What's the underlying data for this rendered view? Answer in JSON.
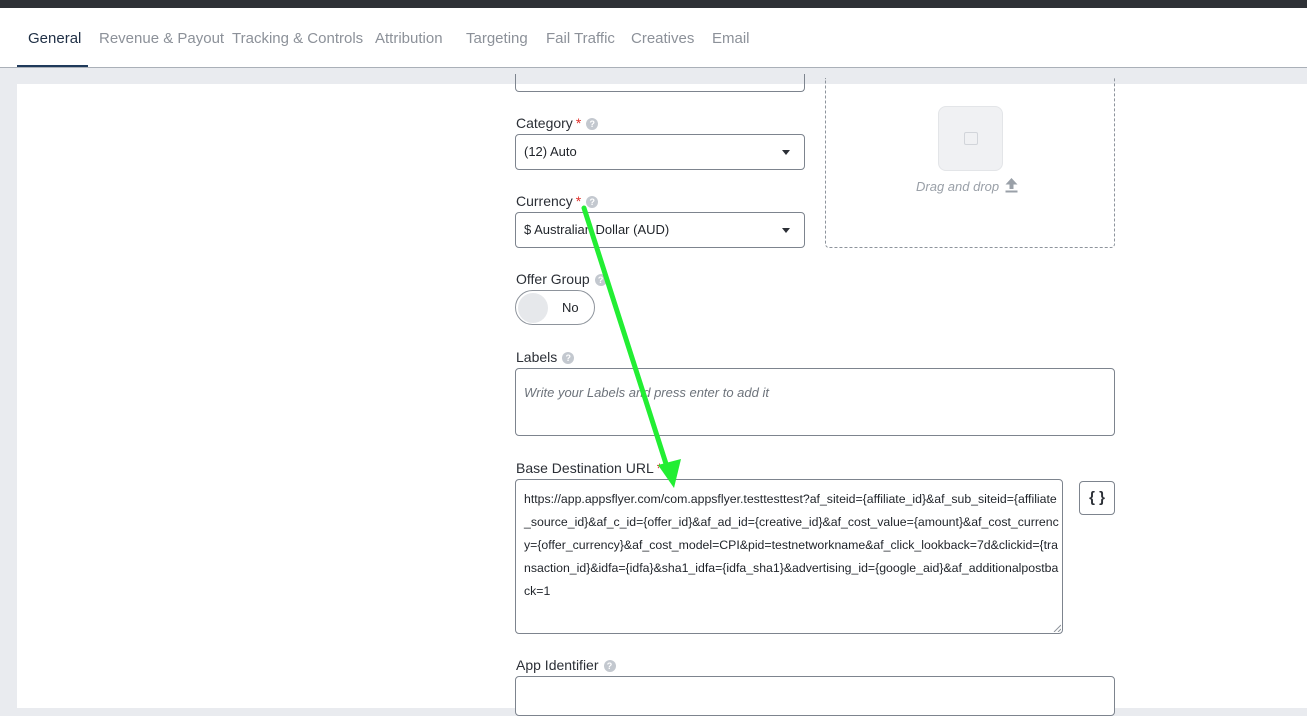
{
  "tabs": [
    {
      "label": "General",
      "active": true
    },
    {
      "label": "Revenue & Payout"
    },
    {
      "label": "Tracking & Controls"
    },
    {
      "label": "Attribution"
    },
    {
      "label": "Targeting"
    },
    {
      "label": "Fail Traffic"
    },
    {
      "label": "Creatives"
    },
    {
      "label": "Email"
    }
  ],
  "form": {
    "category": {
      "label": "Category",
      "required_mark": "*",
      "value": "(12) Auto"
    },
    "currency": {
      "label": "Currency",
      "required_mark": "*",
      "value": "$ Australian Dollar (AUD)"
    },
    "offer_group": {
      "label": "Offer Group",
      "toggle_text": "No"
    },
    "labels": {
      "label": "Labels",
      "placeholder": "Write your Labels and press enter to add it"
    },
    "base_url": {
      "label": "Base Destination URL",
      "required_mark": "*",
      "value": "https://app.appsflyer.com/com.appsflyer.testtesttest?af_siteid={affiliate_id}&af_sub_siteid={affiliate_source_id}&af_c_id={offer_id}&af_ad_id={creative_id}&af_cost_value={amount}&af_cost_currency={offer_currency}&af_cost_model=CPI&pid=testnetworkname&af_click_lookback=7d&clickid={transaction_id}&idfa={idfa}&sha1_idfa={idfa_sha1}&advertising_id={google_aid}&af_additionalpostback=1",
      "macro_button": "{ }"
    },
    "app_identifier": {
      "label": "App Identifier"
    }
  },
  "dropzone": {
    "text": "Drag and drop"
  },
  "help_glyph": "?",
  "colors": {
    "required": "#e0302b",
    "annotation_arrow": "#22ee33",
    "active_tab": "#1f2f45"
  }
}
